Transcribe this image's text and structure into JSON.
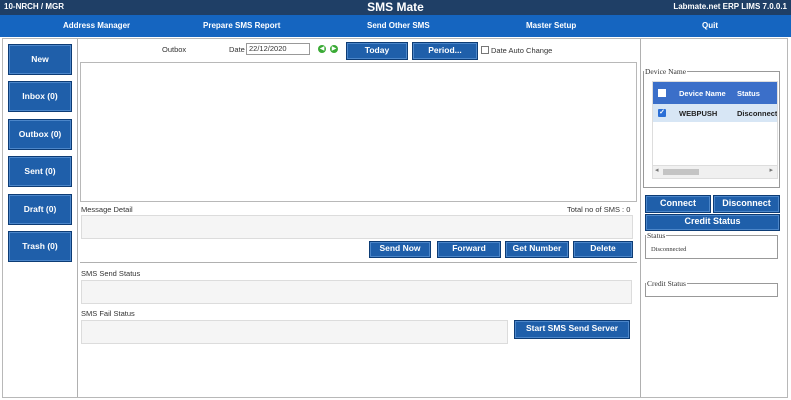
{
  "titlebar": {
    "left": "10-NRCH / MGR",
    "center": "SMS Mate",
    "right": "Labmate.net ERP LIMS 7.0.0.1"
  },
  "menu": [
    "Address Manager",
    "Prepare SMS Report",
    "Send Other SMS",
    "Master Setup",
    "Quit"
  ],
  "nav": [
    "New",
    "Inbox (0)",
    "Outbox (0)",
    "Sent (0)",
    "Draft (0)",
    "Trash (0)"
  ],
  "toolbar": {
    "folder_label": "Outbox",
    "date_label": "Date",
    "date_value": "22/12/2020",
    "prev_icon": "◀",
    "next_icon": "▶",
    "today_label": "Today",
    "period_label": "Period...",
    "auto_change_label": "Date Auto Change"
  },
  "message": {
    "detail_label": "Message Detail",
    "total_label": "Total no of SMS : 0"
  },
  "actions": {
    "send_now": "Send Now",
    "forward": "Forward",
    "get_number": "Get Number",
    "delete": "Delete"
  },
  "status": {
    "send_status_label": "SMS Send Status",
    "fail_status_label": "SMS Fail Status",
    "start_server_label": "Start SMS Send Server"
  },
  "device": {
    "legend": "Device Name",
    "col_name": "Device Name",
    "col_status": "Status",
    "row_name": "WEBPUSH",
    "row_status": "Disconnected",
    "row_checked": true,
    "scroll_left": "◂",
    "scroll_right": "▸"
  },
  "right_buttons": {
    "connect": "Connect",
    "disconnect": "Disconnect",
    "credit_status": "Credit Status"
  },
  "status_box": {
    "legend": "Status",
    "value": "Disconnected"
  },
  "credit_box": {
    "legend": "Credit Status"
  },
  "colors": {
    "titlebar": "#1f3f66",
    "menubar": "#1565c0",
    "button": "#1f5faa",
    "table_header": "#3b6fc9",
    "selected_row": "#d7e6f5",
    "arrow": "#3aaa35"
  }
}
